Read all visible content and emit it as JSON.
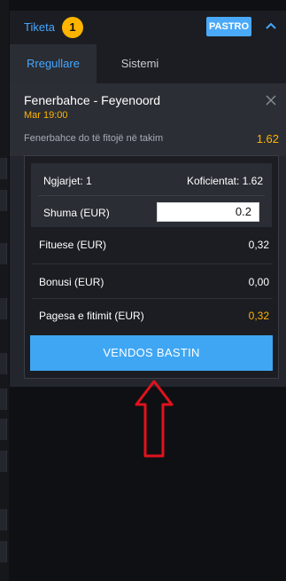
{
  "header": {
    "title": "Tiketa",
    "count": "1",
    "clear_label": "PASTRO"
  },
  "tabs": [
    {
      "label": "Rregullare",
      "active": true
    },
    {
      "label": "Sistemi",
      "active": false
    }
  ],
  "event": {
    "match": "Fenerbahce - Feyenoord",
    "time": "Mar 19:00",
    "selection": "Fenerbahce do të fitojë në takim",
    "odd": "1.62"
  },
  "calc": {
    "events_label": "Ngjarjet: 1",
    "coef_label": "Koficientat: 1.62",
    "stake_label": "Shuma (EUR)",
    "stake_value": "0.2",
    "win_label": "Fituese (EUR)",
    "win_value": "0,32",
    "bonus_label": "Bonusi (EUR)",
    "bonus_value": "0,00",
    "payout_label": "Pagesa e fitimit (EUR)",
    "payout_value": "0,32"
  },
  "place_bet_label": "VENDOS BASTIN",
  "colors": {
    "accent": "#46a6ff",
    "badge": "#ffb400",
    "button": "#3fa6f3",
    "odd": "#ffb400",
    "arrow": "#e0121d"
  }
}
